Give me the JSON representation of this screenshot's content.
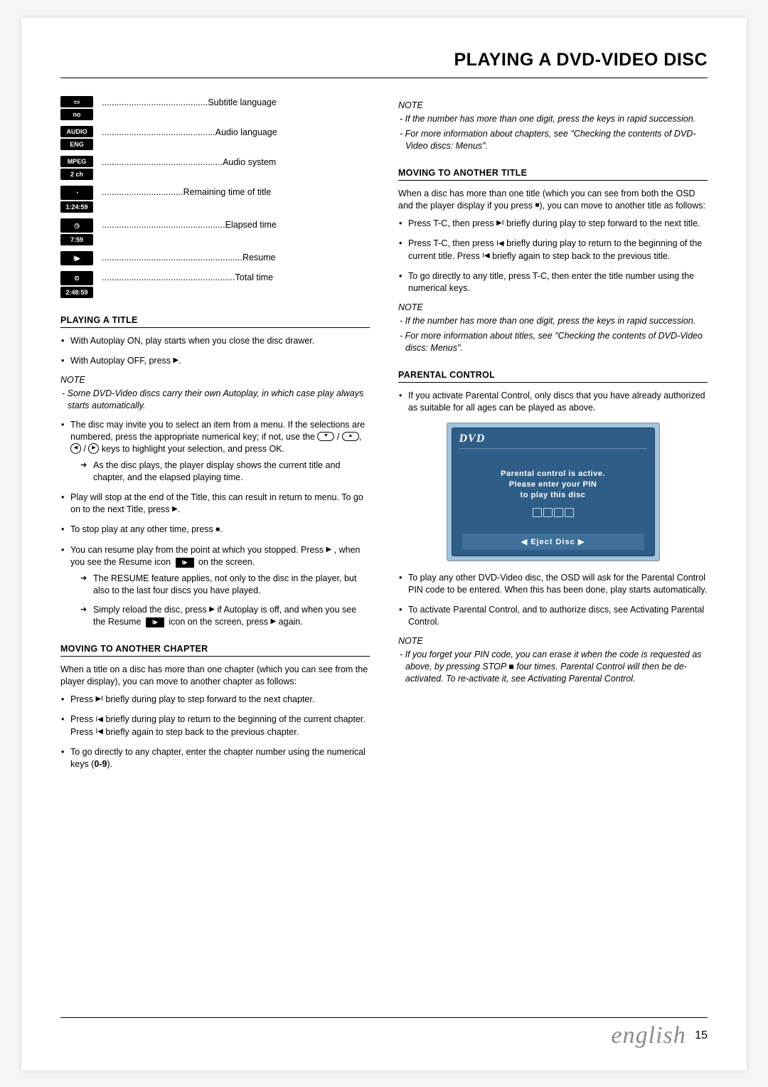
{
  "header": {
    "title": "PLAYING A DVD-VIDEO DISC"
  },
  "iconList": [
    {
      "top": "▭",
      "bot": "no",
      "label": "Subtitle language"
    },
    {
      "top": "AUDIO",
      "bot": "ENG",
      "label": "Audio language"
    },
    {
      "top": "MPEG",
      "bot": "2 ch",
      "label": "Audio system"
    },
    {
      "top": "◔",
      "bot": "1:24:59",
      "label": "Remaining time of title"
    },
    {
      "top": "◷",
      "bot": "7:59",
      "label": "Elapsed time"
    },
    {
      "top": "I▶",
      "bot": "",
      "label": "Resume"
    },
    {
      "top": "⏲",
      "bot": "2:48:59",
      "label": "Total time"
    }
  ],
  "left": {
    "playingTitle": {
      "heading": "PLAYING A TITLE",
      "b1": "With Autoplay ON, play starts when you close the disc drawer.",
      "b2a": "With Autoplay OFF, press ",
      "b2b": ".",
      "noteH": "NOTE",
      "note1": "- Some DVD-Video discs carry their own Autoplay, in which case play always starts automatically.",
      "b3a": "The disc may invite you to select an item from a menu. If the selections are numbered, press the appropriate numerical key; if not, use the ",
      "b3b": " keys to highlight your selection, and press OK.",
      "b3arrow": "As the disc plays, the player display shows the current title and chapter, and the elapsed playing time.",
      "b4a": "Play will stop at the end of the Title, this can result in return to menu. To go on to the next Title, press ",
      "b4b": ".",
      "b5a": "To stop play at any other time, press ",
      "b5b": ".",
      "b6a": "You can resume play from the point at which you stopped. Press ",
      "b6b": " , when you see the Resume icon ",
      "b6c": " on the screen.",
      "b6arrow1": "The RESUME feature applies, not only to the disc in the player, but also to the last four discs you have played.",
      "b6arrow2a": "Simply reload the disc, press ",
      "b6arrow2b": " if Autoplay is off, and when you see the Resume ",
      "b6arrow2c": " icon on the screen, press ",
      "b6arrow2d": " again."
    },
    "movingChapter": {
      "heading": "MOVING TO ANOTHER CHAPTER",
      "intro": "When a title on a disc has more than one chapter (which you can see from the player display), you can move to another chapter as follows:",
      "b1a": "Press ",
      "b1b": " briefly during play to step forward to the next chapter.",
      "b2a": "Press ",
      "b2b": " briefly during play to return to the beginning of the current chapter. Press ",
      "b2c": " briefly again to step back to the previous chapter.",
      "b3a": "To go directly to any chapter, enter the chapter number using the numerical keys (",
      "b3b": "0-9",
      "b3c": ")."
    }
  },
  "right": {
    "topNote": {
      "heading": "NOTE",
      "n1": "- If the number has more than one digit, press the keys in rapid succession.",
      "n2": "- For more information about chapters, see \"Checking the contents of DVD-Video discs: Menus\"."
    },
    "movingTitle": {
      "heading": "MOVING TO ANOTHER TITLE",
      "introA": "When a disc has more than one title (which you can see from both the OSD and the player display if you press ",
      "introB": "), you can move to another title as follows:",
      "b1a": "Press T-C, then press ",
      "b1b": " briefly during play to step forward to the next title.",
      "b2a": "Press T-C, then press ",
      "b2b": " briefly during play to return to the beginning of the current title. Press ",
      "b2c": " briefly again to step back to the previous title.",
      "b3": "To go directly to any title, press T-C, then enter the title number using the numerical keys.",
      "noteH": "NOTE",
      "n1": "- If the number has more than one digit, press the keys in rapid succession.",
      "n2": "- For more information about titles, see \"Checking the contents of DVD-Video discs: Menus\"."
    },
    "parental": {
      "heading": "PARENTAL CONTROL",
      "b1": "If you activate Parental Control, only discs that you have already authorized as suitable for all ages can be played as above.",
      "osd": {
        "logo": "DVD",
        "msg1": "Parental control is active.",
        "msg2": "Please enter your PIN",
        "msg3": "to play this disc",
        "bar": "◀ Eject Disc ▶"
      },
      "b2": "To play any other DVD-Video disc, the OSD will ask for the Parental Control PIN code to be entered. When this has been done, play starts automatically.",
      "b3": "To activate Parental Control, and to authorize discs, see Activating Parental Control.",
      "noteH": "NOTE",
      "n1a": "- If you forget your PIN code, you can erase it when the code is requested as above, by pressing STOP ",
      "n1b": " four times. Parental Control will then be de-activated. To re-activate it, see Activating Parental Control."
    }
  },
  "glyphs": {
    "play": "▶",
    "stop": "■",
    "next": "▶I",
    "prev": "I◀",
    "resume": "I▶"
  },
  "footer": {
    "lang": "english",
    "page": "15"
  }
}
